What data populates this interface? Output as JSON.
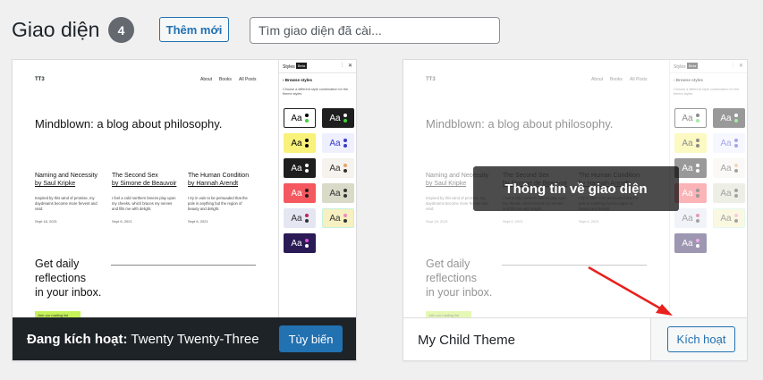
{
  "header": {
    "title": "Giao diện",
    "count": "4",
    "add_new_label": "Thêm mới",
    "search_placeholder": "Tìm giao diện đã cài..."
  },
  "preview": {
    "site_title": "TT3",
    "nav": [
      "About",
      "Books",
      "All Posts"
    ],
    "hero": "Mindblown: a blog about philosophy.",
    "posts": [
      {
        "title": "Naming and Necessity by Saul Kripke",
        "title_a": "Naming and Necessity",
        "author": "by Saul Kripke",
        "text": "Inspired by this wind of promise, my daydreams become more fervent and vivid.",
        "date": "Sept 16, 2021"
      },
      {
        "title_a": "The Second Sex",
        "author": "by Simone de Beauvoir",
        "text": "I feel a cold northern breeze play upon my cheeks, which braces my nerves and fills me with delight.",
        "date": "Sept 6, 2021"
      },
      {
        "title_a": "The Human Condition",
        "author": "by Hannah Arendt",
        "text": "I try in vain to be persuaded that the pole is anything but the region of beauty and delight.",
        "date": "Sept 6, 2021"
      }
    ],
    "cta_lines": [
      "Get daily",
      "reflections",
      "in your inbox."
    ],
    "mail_button": "Join our mailing list",
    "styles_panel": {
      "heading": "Styles",
      "beta": "Beta",
      "browse": "Browse styles",
      "description": "Choose a different style combination for the theme styles",
      "swatch_text": "Aa",
      "swatches": [
        {
          "bg": "#ffffff",
          "fg": "#000000",
          "d1": "#000000",
          "d2": "#3ad43a",
          "border": "#1e1e1e"
        },
        {
          "bg": "#1e1e1e",
          "fg": "#ffffff",
          "d1": "#ffffff",
          "d2": "#3ad43a",
          "border": "#1e1e1e"
        },
        {
          "bg": "#f9f27a",
          "fg": "#000000",
          "d1": "#000000",
          "d2": "#000000",
          "border": "#f9f27a"
        },
        {
          "bg": "#eef0ff",
          "fg": "#3b3bcc",
          "d1": "#3b3bcc",
          "d2": "#3b3bcc",
          "border": "#eef0ff"
        },
        {
          "bg": "#1e1e1e",
          "fg": "#ffffff",
          "d1": "#ffffff",
          "d2": "#ffffff",
          "border": "#1e1e1e"
        },
        {
          "bg": "#f6f3ee",
          "fg": "#333333",
          "d1": "#e0a76b",
          "d2": "#333333",
          "border": "#f6f3ee"
        },
        {
          "bg": "#f5585f",
          "fg": "#ffffff",
          "d1": "#1e1e1e",
          "d2": "#1e1e1e",
          "border": "#f5585f"
        },
        {
          "bg": "#d9dac8",
          "fg": "#333333",
          "d1": "#333333",
          "d2": "#333333",
          "border": "#d9dac8"
        },
        {
          "bg": "#e4e6f2",
          "fg": "#333333",
          "d1": "#c0245c",
          "d2": "#333333",
          "border": "#e4e6f2"
        },
        {
          "bg": "#f7f0c0",
          "fg": "#333333",
          "d1": "#f08ac0",
          "d2": "#333333",
          "border": "#c7f0e0"
        },
        {
          "bg": "#2a1a55",
          "fg": "#ffffff",
          "d1": "#e04fcf",
          "d2": "#ffffff",
          "border": "#2a1a55"
        }
      ]
    }
  },
  "active_theme": {
    "status_label": "Đang kích hoạt:",
    "name": "Twenty Twenty-Three",
    "customize_label": "Tùy biến"
  },
  "child_theme": {
    "name": "My Child Theme",
    "activate_label": "Kích hoạt",
    "details_label": "Thông tin về giao diện"
  },
  "annotation_color": "#e8211e"
}
